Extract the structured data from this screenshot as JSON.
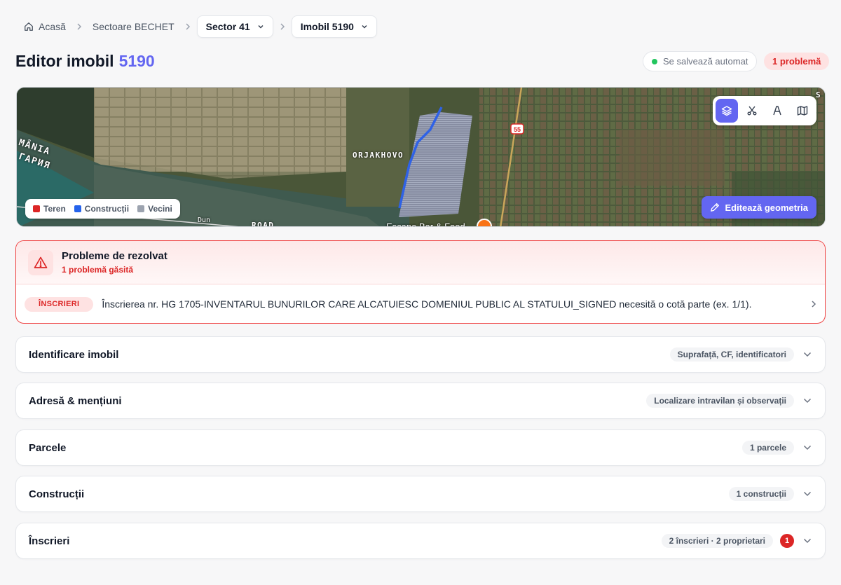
{
  "breadcrumb": {
    "home": "Acasă",
    "sector_group": "Sectoare BECHET",
    "sector": "Sector 41",
    "property": "Imobil 5190"
  },
  "header": {
    "title_prefix": "Editor imobil",
    "title_number": "5190",
    "autosave_status": "Se salvează automat",
    "issues_badge": "1 problemă"
  },
  "map": {
    "labels": {
      "town": "ORJAKHOVO",
      "road": "55",
      "country_ro": "MÂNIA",
      "country_bg": "ГАРИЯ",
      "river": "Dun",
      "place_bottom": "Escape Bar & Food",
      "road_bottom": "ROAD",
      "corner": "S"
    },
    "tools": [
      "layers-icon",
      "scissors-icon",
      "measure-icon",
      "map-icon"
    ],
    "active_tool": "layers-icon",
    "legend": [
      {
        "label": "Teren",
        "color": "#dc2626"
      },
      {
        "label": "Construcții",
        "color": "#2563eb"
      },
      {
        "label": "Vecini",
        "color": "#9ca3af"
      }
    ],
    "edit_button": "Editează geometria"
  },
  "problems": {
    "title": "Probleme de rezolvat",
    "subtitle": "1 problemă găsită",
    "items": [
      {
        "tag": "ÎNSCRIERI",
        "text": "Înscrierea nr. HG 1705-INVENTARUL BUNURILOR CARE ALCATUIESC DOMENIUL PUBLIC AL STATULUI_SIGNED necesită o cotă parte (ex. 1/1)."
      }
    ]
  },
  "sections": [
    {
      "title": "Identificare imobil",
      "badge": "Suprafață, CF, identificatori"
    },
    {
      "title": "Adresă & mențiuni",
      "badge": "Localizare intravilan și observații"
    },
    {
      "title": "Parcele",
      "badge": "1 parcele"
    },
    {
      "title": "Construcții",
      "badge": "1 construcții"
    },
    {
      "title": "Înscrieri",
      "badge": "2 înscrieri · 2 proprietari",
      "count": "1"
    }
  ],
  "colors": {
    "accent": "#6366f1",
    "danger": "#dc2626",
    "success": "#22c55e"
  }
}
